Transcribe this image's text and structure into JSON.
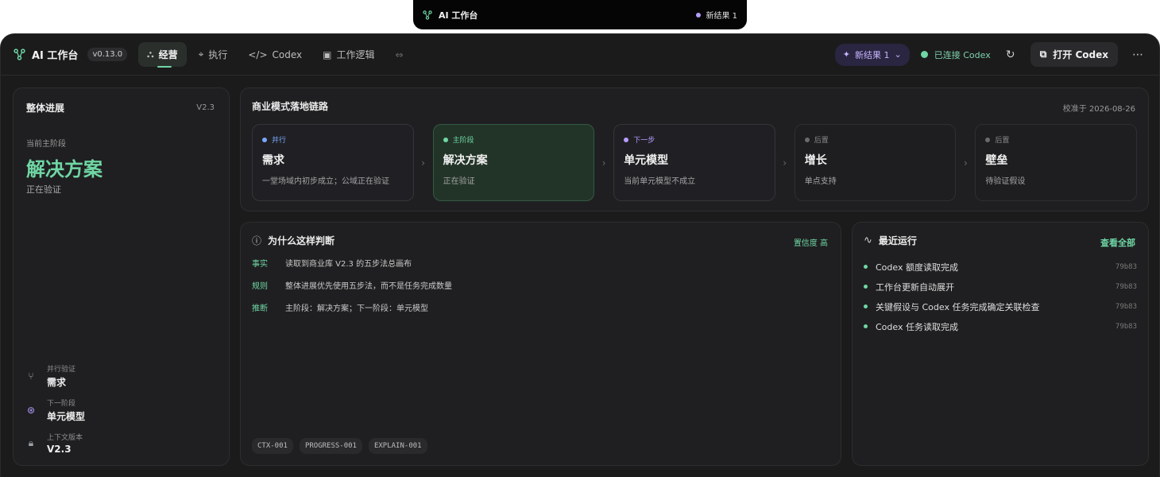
{
  "mini_bar": {
    "title": "AI 工作台",
    "status": "新结果 1"
  },
  "header": {
    "app_name": "AI 工作台",
    "version": "v0.13.0",
    "tabs": [
      {
        "label": "经营",
        "icon": "nodes-icon",
        "active": true
      },
      {
        "label": "执行",
        "icon": "target-icon",
        "active": false
      },
      {
        "label": "Codex",
        "icon": "code-icon",
        "active": false
      },
      {
        "label": "工作逻辑",
        "icon": "image-icon",
        "active": false
      }
    ],
    "new_results": "新结果 1",
    "connection": "已连接 Codex",
    "open_button": "打开 Codex"
  },
  "overview": {
    "title": "整体进展",
    "version": "V2.3",
    "current_label": "当前主阶段",
    "current_stage": "解决方案",
    "current_status": "正在验证",
    "meta": [
      {
        "key": "并行验证",
        "value": "需求",
        "icon": "fork-icon"
      },
      {
        "key": "下一阶段",
        "value": "单元模型",
        "icon": "arrow-circle-icon"
      },
      {
        "key": "上下文版本",
        "value": "V2.3",
        "icon": "lock-icon"
      }
    ]
  },
  "chain": {
    "title": "商业模式落地链路",
    "date": "校准于 2026-08-26",
    "steps": [
      {
        "kind": "并行",
        "name": "需求",
        "desc": "一堂场域内初步成立；公域正在验证",
        "color": "#7aa7ff",
        "variant": "normal"
      },
      {
        "kind": "主阶段",
        "name": "解决方案",
        "desc": "正在验证",
        "color": "#6fd6a4",
        "variant": "main"
      },
      {
        "kind": "下一步",
        "name": "单元模型",
        "desc": "当前单元模型不成立",
        "color": "#b59cff",
        "variant": "normal"
      },
      {
        "kind": "后置",
        "name": "增长",
        "desc": "单点支持",
        "color": "#6a6a6a",
        "variant": "dim"
      },
      {
        "kind": "后置",
        "name": "壁垒",
        "desc": "待验证假设",
        "color": "#6a6a6a",
        "variant": "dim"
      }
    ]
  },
  "why": {
    "title": "为什么这样判断",
    "confidence": "置信度 高",
    "rows": [
      {
        "k": "事实",
        "v": "读取到商业库 V2.3 的五步法总画布"
      },
      {
        "k": "规则",
        "v": "整体进展优先使用五步法，而不是任务完成数量"
      },
      {
        "k": "推断",
        "v": "主阶段：解决方案；下一阶段：单元模型"
      }
    ],
    "tags": [
      "CTX-001",
      "PROGRESS-001",
      "EXPLAIN-001"
    ]
  },
  "runs": {
    "title": "最近运行",
    "view_all": "查看全部",
    "items": [
      {
        "label": "Codex 额度读取完成",
        "hash": "79b83"
      },
      {
        "label": "工作台更新自动展开",
        "hash": "79b83"
      },
      {
        "label": "关键假设与 Codex 任务完成确定关联检查",
        "hash": "79b83"
      },
      {
        "label": "Codex 任务读取完成",
        "hash": "79b83"
      }
    ]
  }
}
